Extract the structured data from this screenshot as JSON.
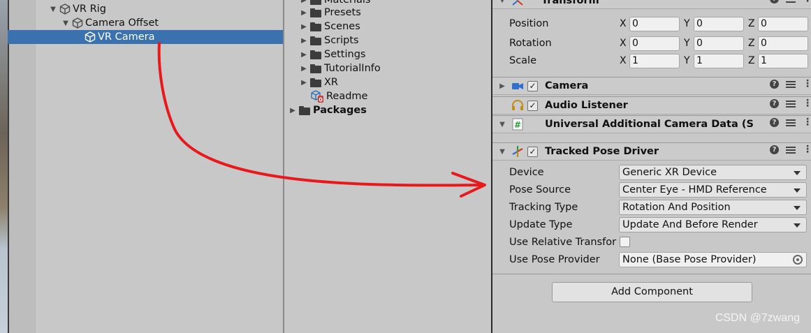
{
  "hierarchy": {
    "items": [
      {
        "label": "VR Rig",
        "expanded": true
      },
      {
        "label": "Camera Offset",
        "expanded": true
      },
      {
        "label": "VR Camera",
        "selected": true
      }
    ]
  },
  "project": {
    "items": [
      {
        "label": "Materials"
      },
      {
        "label": "Presets"
      },
      {
        "label": "Scenes"
      },
      {
        "label": "Scripts"
      },
      {
        "label": "Settings"
      },
      {
        "label": "TutorialInfo"
      },
      {
        "label": "XR"
      },
      {
        "label": "Readme"
      },
      {
        "label": "Packages"
      }
    ]
  },
  "inspector": {
    "transform": {
      "title": "Transform",
      "position_label": "Position",
      "rotation_label": "Rotation",
      "scale_label": "Scale",
      "axis_x": "X",
      "axis_y": "Y",
      "axis_z": "Z",
      "position": {
        "x": "0",
        "y": "0",
        "z": "0"
      },
      "rotation": {
        "x": "0",
        "y": "0",
        "z": "0"
      },
      "scale": {
        "x": "1",
        "y": "1",
        "z": "1"
      }
    },
    "components": [
      {
        "title": "Camera",
        "checked": "✓"
      },
      {
        "title": "Audio Listener",
        "checked": "✓"
      },
      {
        "title": "Universal Additional Camera Data (Scrip"
      },
      {
        "title": "Tracked Pose Driver",
        "checked": "✓"
      }
    ],
    "tracked_pose_driver": {
      "device_label": "Device",
      "device_value": "Generic XR Device",
      "pose_source_label": "Pose Source",
      "pose_source_value": "Center Eye - HMD Reference",
      "tracking_type_label": "Tracking Type",
      "tracking_type_value": "Rotation And Position",
      "update_type_label": "Update Type",
      "update_type_value": "Update And Before Render",
      "use_relative_label": "Use Relative Transfor",
      "use_pose_provider_label": "Use Pose Provider",
      "use_pose_provider_value": "None (Base Pose Provider)"
    },
    "add_component_label": "Add Component"
  },
  "watermark": "CSDN @7zwang",
  "colors": {
    "selection": "#3a72b0",
    "panel_bg": "#c8c8c8",
    "annotation_arrow": "#e8191c"
  }
}
